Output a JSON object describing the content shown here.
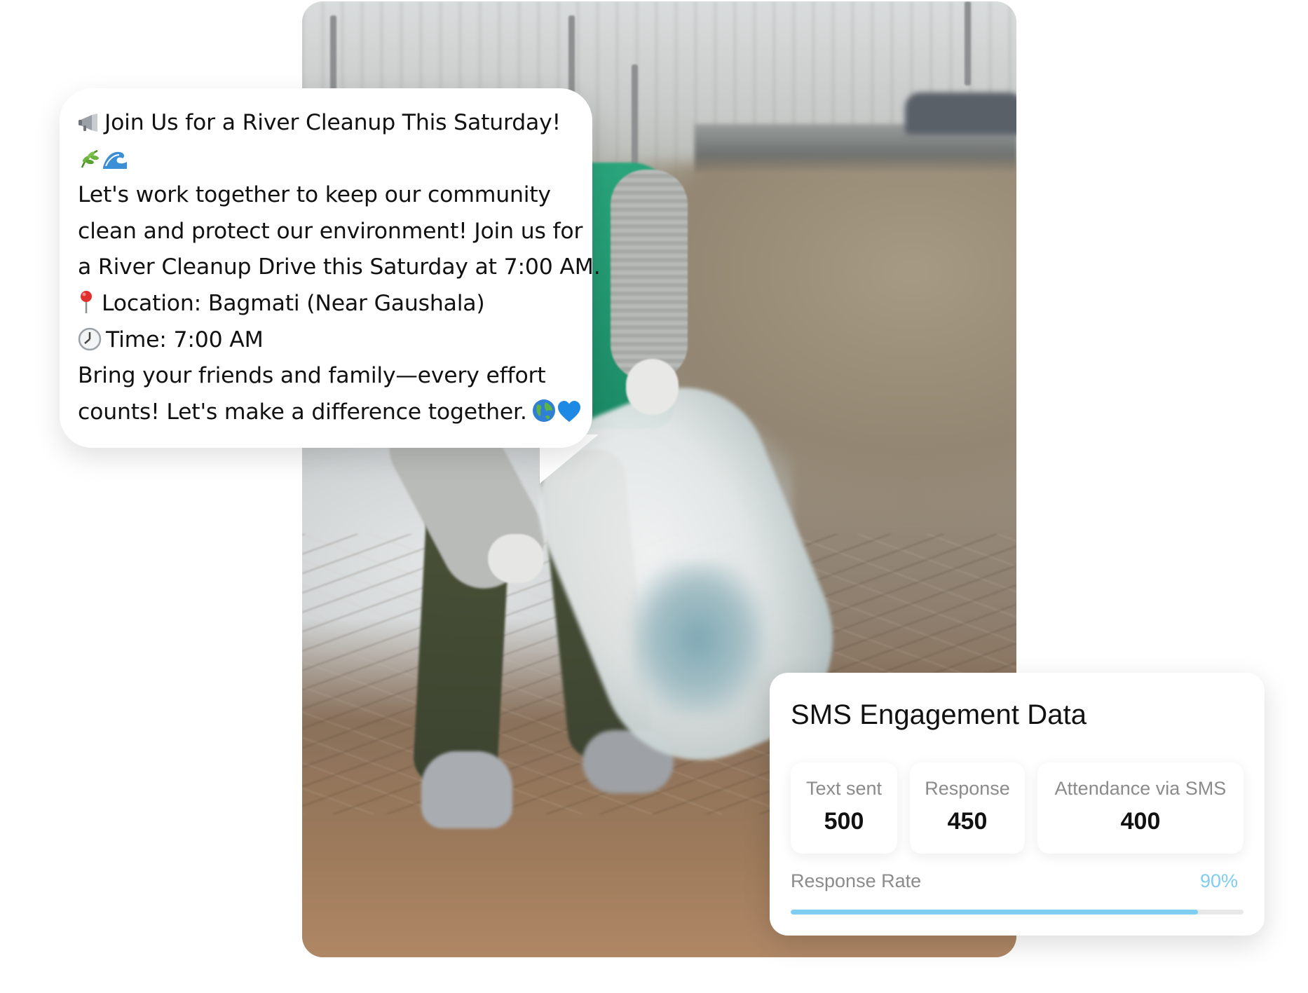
{
  "message": {
    "lines": [
      "Join Us for a River Cleanup This Saturday!",
      "",
      "Let's work together to keep our community",
      "clean and protect our environment! Join us for",
      "a River Cleanup Drive this Saturday at 7:00 AM.",
      "Location: Bagmati (Near Gaushala)",
      "Time: 7:00 AM",
      "Bring your friends and family—every effort",
      "counts! Let's make a difference together."
    ],
    "icons": {
      "title": "megaphone-icon",
      "title_extra": [
        "herb-icon",
        "water-wave-icon"
      ],
      "location": "round-pushpin-icon",
      "time": "clock-icon",
      "closing": [
        "globe-icon",
        "blue-heart-icon"
      ]
    }
  },
  "engagement": {
    "title": "SMS Engagement Data",
    "stats": [
      {
        "label": "Text sent",
        "value": "500"
      },
      {
        "label": "Response",
        "value": "450"
      },
      {
        "label": "Attendance via SMS",
        "value": "400"
      }
    ],
    "rate": {
      "label": "Response Rate",
      "display": "90%",
      "fraction": 0.9
    }
  },
  "colors": {
    "accent": "#7fcdf0",
    "muted_text": "#8b8b8b",
    "text": "#111111",
    "vest_green": "#1b8b66"
  }
}
